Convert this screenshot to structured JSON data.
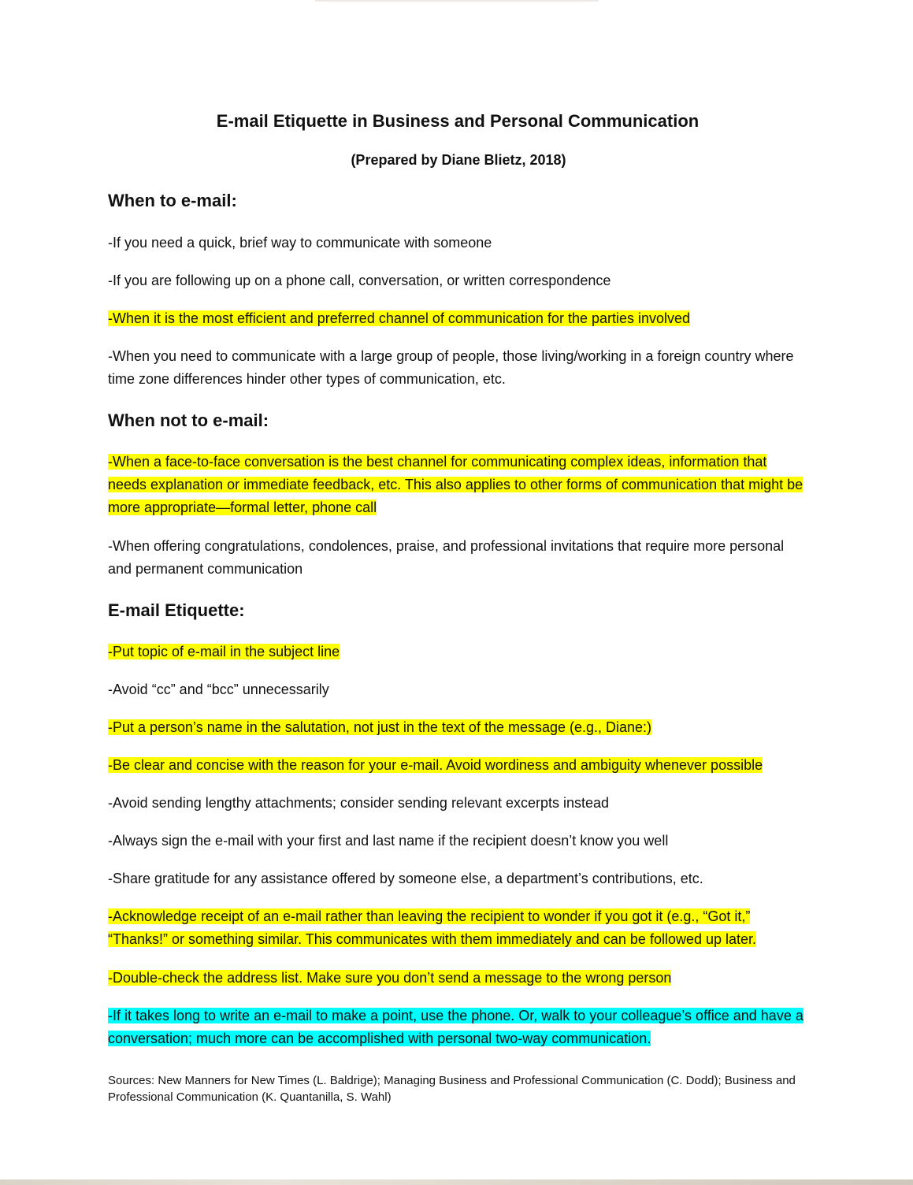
{
  "doc": {
    "title": "E-mail Etiquette in Business and Personal Communication",
    "subtitle": "(Prepared by Diane Blietz, 2018)",
    "sections": [
      {
        "heading": "When to e-mail:",
        "items": [
          "-If you need a quick, brief way to communicate with someone",
          "-If you are following up on a phone call, conversation, or written correspondence",
          "-When it is the most efficient and preferred channel of communication for the parties involved",
          "-When you need to communicate with a large group of people, those living/working in a foreign country where time zone differences hinder other types of communication, etc."
        ]
      },
      {
        "heading": "When not to e-mail:",
        "items": [
          "-When a face-to-face conversation is the best channel for communicating complex ideas, information that needs explanation or immediate feedback, etc. This also applies to other forms of communication that might be more appropriate—formal letter, phone call",
          "-When offering congratulations, condolences, praise, and professional invitations that require more personal and permanent communication"
        ]
      },
      {
        "heading": "E-mail Etiquette:",
        "items": [
          "-Put topic of e-mail in the subject line",
          "-Avoid “cc” and “bcc” unnecessarily",
          "-Put a person’s name in the salutation, not just in the text of the message (e.g., Diane:)",
          "-Be clear and concise with the reason for your e-mail. Avoid wordiness and ambiguity whenever possible",
          "-Avoid sending lengthy attachments; consider sending relevant excerpts instead",
          "-Always sign the e-mail with your first and last name if the recipient doesn’t know you well",
          "-Share gratitude for any assistance offered by someone else, a department’s contributions, etc.",
          "-Acknowledge receipt of an e-mail rather than leaving the recipient to wonder if you got it (e.g., “Got it,” “Thanks!” or something similar. This communicates with them immediately and can be followed up later.",
          "-Double-check the address list. Make sure you don’t send a message to the wrong person",
          "-If it takes long to write an e-mail to make a point, use the phone. Or, walk to your colleague’s office and have a conversation; much more can be accomplished with personal two-way communication."
        ]
      }
    ],
    "sources": "Sources: New Manners for New Times (L. Baldrige); Managing Business and Professional Communication (C. Dodd); Business and Professional Communication (K. Quantanilla, S. Wahl)"
  },
  "colors": {
    "highlight_yellow": "#ffff00",
    "highlight_cyan": "#00ffff"
  }
}
